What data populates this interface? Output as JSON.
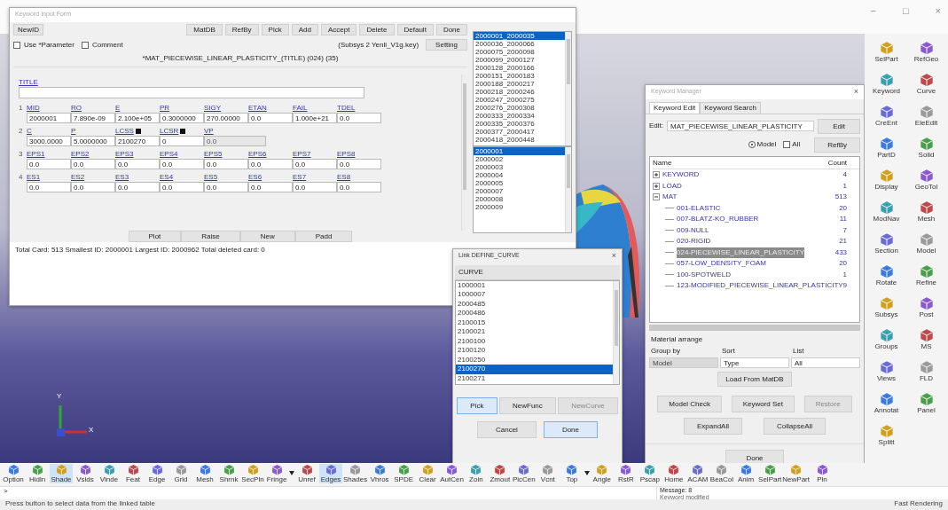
{
  "window_controls": [
    "−",
    "□",
    "×"
  ],
  "keyword_input_form": {
    "title": "Keyword Input Form",
    "left_buttons": [
      "NewID"
    ],
    "buttons": [
      "MatDB",
      "RefBy",
      "Pick",
      "Add",
      "Accept",
      "Delete",
      "Default",
      "Done"
    ],
    "options": [
      {
        "label": "Use *Parameter",
        "checked": false
      },
      {
        "label": "Comment",
        "checked": false
      }
    ],
    "subsys": "(Subsys 2 Yenli_V1g.key)",
    "setting_button": "Setting",
    "header": "*MAT_PIECEWISE_LINEAR_PLASTICITY_(TITLE) (024)   (35)",
    "title_label": "TITLE",
    "cards": [
      {
        "number": "1",
        "fields": [
          {
            "label": "MID",
            "value": "2000001"
          },
          {
            "label": "RO",
            "value": "7.890e-09"
          },
          {
            "label": "E",
            "value": "2.100e+05"
          },
          {
            "label": "PR",
            "value": "0.3000000"
          },
          {
            "label": "SIGY",
            "value": "270.00000"
          },
          {
            "label": "ETAN",
            "value": "0.0"
          },
          {
            "label": "FAIL",
            "value": "1.000e+21"
          },
          {
            "label": "TDEL",
            "value": "0.0"
          }
        ]
      },
      {
        "number": "2",
        "fields": [
          {
            "label": "C",
            "value": "3000.0000"
          },
          {
            "label": "P",
            "value": "5.0000000"
          },
          {
            "label": "LCSS",
            "value": "2100270",
            "kind": "linked"
          },
          {
            "label": "LCSR",
            "value": "0",
            "kind": "linked"
          },
          {
            "label": "VP",
            "value": "0.0",
            "kind": "select"
          }
        ]
      },
      {
        "number": "3",
        "fields": [
          {
            "label": "EPS1",
            "value": "0.0"
          },
          {
            "label": "EPS2",
            "value": "0.0"
          },
          {
            "label": "EPS3",
            "value": "0.0"
          },
          {
            "label": "EPS4",
            "value": "0.0"
          },
          {
            "label": "EPS5",
            "value": "0.0"
          },
          {
            "label": "EPS6",
            "value": "0.0"
          },
          {
            "label": "EPS7",
            "value": "0.0"
          },
          {
            "label": "EPS8",
            "value": "0.0"
          }
        ]
      },
      {
        "number": "4",
        "fields": [
          {
            "label": "ES1",
            "value": "0.0"
          },
          {
            "label": "ES2",
            "value": "0.0"
          },
          {
            "label": "ES3",
            "value": "0.0"
          },
          {
            "label": "ES4",
            "value": "0.0"
          },
          {
            "label": "ES5",
            "value": "0.0"
          },
          {
            "label": "ES6",
            "value": "0.0"
          },
          {
            "label": "ES7",
            "value": "0.0"
          },
          {
            "label": "ES8",
            "value": "0.0"
          }
        ]
      }
    ],
    "bottom_buttons": [
      "Plot",
      "Raise",
      "New",
      "Padd"
    ],
    "summary": "Total Card: 513   Smallest ID: 2000001   Largest ID: 2000962   Total deleted card: 0",
    "range_list": [
      {
        "label": "2000001_2000035",
        "selected": true
      },
      {
        "label": "2000036_2000066",
        "selected": false
      },
      {
        "label": "2000075_2000098",
        "selected": false
      },
      {
        "label": "2000099_2000127",
        "selected": false
      },
      {
        "label": "2000128_2000166",
        "selected": false
      },
      {
        "label": "2000151_2000183",
        "selected": false
      },
      {
        "label": "2000188_2000217",
        "selected": false
      },
      {
        "label": "2000218_2000246",
        "selected": false
      },
      {
        "label": "2000247_2000275",
        "selected": false
      },
      {
        "label": "2000276_2000308",
        "selected": false
      },
      {
        "label": "2000333_2000334",
        "selected": false
      },
      {
        "label": "2000335_2000376",
        "selected": false
      },
      {
        "label": "2000377_2000417",
        "selected": false
      },
      {
        "label": "2000418_2000448",
        "selected": false
      }
    ],
    "id_list": [
      {
        "label": "2000001",
        "selected": true
      },
      {
        "label": "2000002",
        "selected": false
      },
      {
        "label": "2000003",
        "selected": false
      },
      {
        "label": "2000004",
        "selected": false
      },
      {
        "label": "2000005",
        "selected": false
      },
      {
        "label": "2000007",
        "selected": false
      },
      {
        "label": "2000008",
        "selected": false
      },
      {
        "label": "2000009",
        "selected": false
      }
    ]
  },
  "curve_dialog": {
    "title": "Link DEFINE_CURVE",
    "close": "×",
    "column": "CURVE",
    "items": [
      {
        "label": "1000001",
        "selected": false
      },
      {
        "label": "1000007",
        "selected": false
      },
      {
        "label": "2000485",
        "selected": false
      },
      {
        "label": "2000486",
        "selected": false
      },
      {
        "label": "2100015",
        "selected": false
      },
      {
        "label": "2100021",
        "selected": false
      },
      {
        "label": "2100100",
        "selected": false
      },
      {
        "label": "2100120",
        "selected": false
      },
      {
        "label": "2100250",
        "selected": false
      },
      {
        "label": "2100270",
        "selected": true
      },
      {
        "label": "2100271",
        "selected": false
      }
    ],
    "buttons": [
      {
        "label": "Pick",
        "disabled": false
      },
      {
        "label": "NewFunc",
        "disabled": false
      },
      {
        "label": "NewCurve",
        "disabled": true
      }
    ],
    "footer_buttons": [
      "Cancel",
      "Done"
    ]
  },
  "keyword_manager": {
    "title": "Keyword Manager",
    "close": "×",
    "tabs": [
      {
        "label": "Keyword Edit",
        "selected": true
      },
      {
        "label": "Keyword Search",
        "selected": false
      }
    ],
    "edit_label": "Edit:",
    "edit_value": "MAT_PIECEWISE_LINEAR_PLASTICITY",
    "edit_button": "Edit",
    "scope": [
      {
        "label": "Model",
        "kind": "radio",
        "selected": true
      },
      {
        "label": "All",
        "kind": "checkbox",
        "selected": false
      }
    ],
    "refby_button": "RefBy",
    "columns": [
      "Name",
      "Count"
    ],
    "tree": [
      {
        "name": "KEYWORD",
        "count": "4",
        "expanded": false,
        "selected": false
      },
      {
        "name": "LOAD",
        "count": "1",
        "expanded": false,
        "selected": false
      },
      {
        "name": "MAT",
        "count": "513",
        "expanded": true,
        "selected": false,
        "children": [
          {
            "name": "001-ELASTIC",
            "count": "20",
            "selected": false
          },
          {
            "name": "007-BLATZ-KO_RUBBER",
            "count": "11",
            "selected": false
          },
          {
            "name": "009-NULL",
            "count": "7",
            "selected": false
          },
          {
            "name": "020-RIGID",
            "count": "21",
            "selected": false
          },
          {
            "name": "024-PIECEWISE_LINEAR_PLASTICITY",
            "count": "433",
            "selected": true
          },
          {
            "name": "057-LOW_DENSITY_FOAM",
            "count": "20",
            "selected": false
          },
          {
            "name": "100-SPOTWELD",
            "count": "1",
            "selected": false
          },
          {
            "name": "123-MODIFIED_PIECEWISE_LINEAR_PLASTICITY",
            "count": "9",
            "selected": false
          }
        ]
      }
    ],
    "arrange_title": "Material arrange",
    "arrange": [
      {
        "label": "Group by",
        "value": "Model",
        "disabled": true
      },
      {
        "label": "Sort",
        "value": "Type",
        "disabled": false
      },
      {
        "label": "List",
        "value": "All",
        "disabled": false
      }
    ],
    "load_button": "Load From MatDB",
    "buttons": [
      {
        "label": "Model Check",
        "disabled": false
      },
      {
        "label": "Keyword Set",
        "disabled": false
      },
      {
        "label": "Restore",
        "disabled": true
      }
    ],
    "expand_buttons": [
      "ExpandAll",
      "CollapseAll"
    ],
    "done_button": "Done"
  },
  "side_toolbar": [
    "SelPart",
    "RefGeo",
    "Keyword",
    "Curve",
    "CreEnt",
    "EleEdit",
    "PartD",
    "Solid",
    "Display",
    "GeoTol",
    "ModNav",
    "Mesh",
    "Section",
    "Model",
    "Rotate",
    "Refine",
    "Subsys",
    "Post",
    "Groups",
    "MS",
    "Views",
    "FLD",
    "Annotat",
    "Panel",
    "Splitt"
  ],
  "bottom_toolbar": [
    {
      "label": "Option",
      "kind": "tool"
    },
    {
      "label": "Hidln",
      "kind": "tool"
    },
    {
      "label": "Shade",
      "kind": "tool",
      "selected": true
    },
    {
      "label": "Vslds",
      "kind": "tool"
    },
    {
      "label": "Vinde",
      "kind": "tool"
    },
    {
      "label": "Feat",
      "kind": "tool"
    },
    {
      "label": "Edge",
      "kind": "tool"
    },
    {
      "label": "Grid",
      "kind": "tool"
    },
    {
      "label": "Mesh",
      "kind": "tool"
    },
    {
      "label": "Shrnk",
      "kind": "tool"
    },
    {
      "label": "SecPln",
      "kind": "tool"
    },
    {
      "label": "Fringe",
      "kind": "tool"
    },
    {
      "kind": "menu"
    },
    {
      "label": "Unref",
      "kind": "tool"
    },
    {
      "label": "Edges",
      "kind": "tool",
      "selected": true
    },
    {
      "label": "Shades",
      "kind": "tool"
    },
    {
      "label": "Vhros",
      "kind": "tool"
    },
    {
      "label": "SPDE",
      "kind": "tool"
    },
    {
      "label": "Clear",
      "kind": "tool"
    },
    {
      "label": "AutCen",
      "kind": "tool"
    },
    {
      "label": "Zoin",
      "kind": "tool"
    },
    {
      "label": "Zmout",
      "kind": "tool"
    },
    {
      "label": "PicCen",
      "kind": "tool"
    },
    {
      "label": "Vcnt",
      "kind": "tool"
    },
    {
      "label": "Top",
      "kind": "tool"
    },
    {
      "kind": "menu"
    },
    {
      "label": "Angle",
      "kind": "tool"
    },
    {
      "label": "RstR",
      "kind": "tool"
    },
    {
      "label": "Pscap",
      "kind": "tool"
    },
    {
      "label": "Home",
      "kind": "tool"
    },
    {
      "label": "ACAM",
      "kind": "tool"
    },
    {
      "label": "BeaCol",
      "kind": "tool"
    },
    {
      "label": "Anim",
      "kind": "tool"
    },
    {
      "label": "SelPart",
      "kind": "tool"
    },
    {
      "label": "NewPart",
      "kind": "tool"
    },
    {
      "label": "Pln",
      "kind": "tool"
    }
  ],
  "axis_labels": [
    "Y",
    "X"
  ],
  "command_prompt": ">",
  "message": {
    "title": "Message: 8",
    "text": "Keyword modified"
  },
  "status": "Press button to select data from the linked table",
  "render_mode": "Fast Rendering"
}
